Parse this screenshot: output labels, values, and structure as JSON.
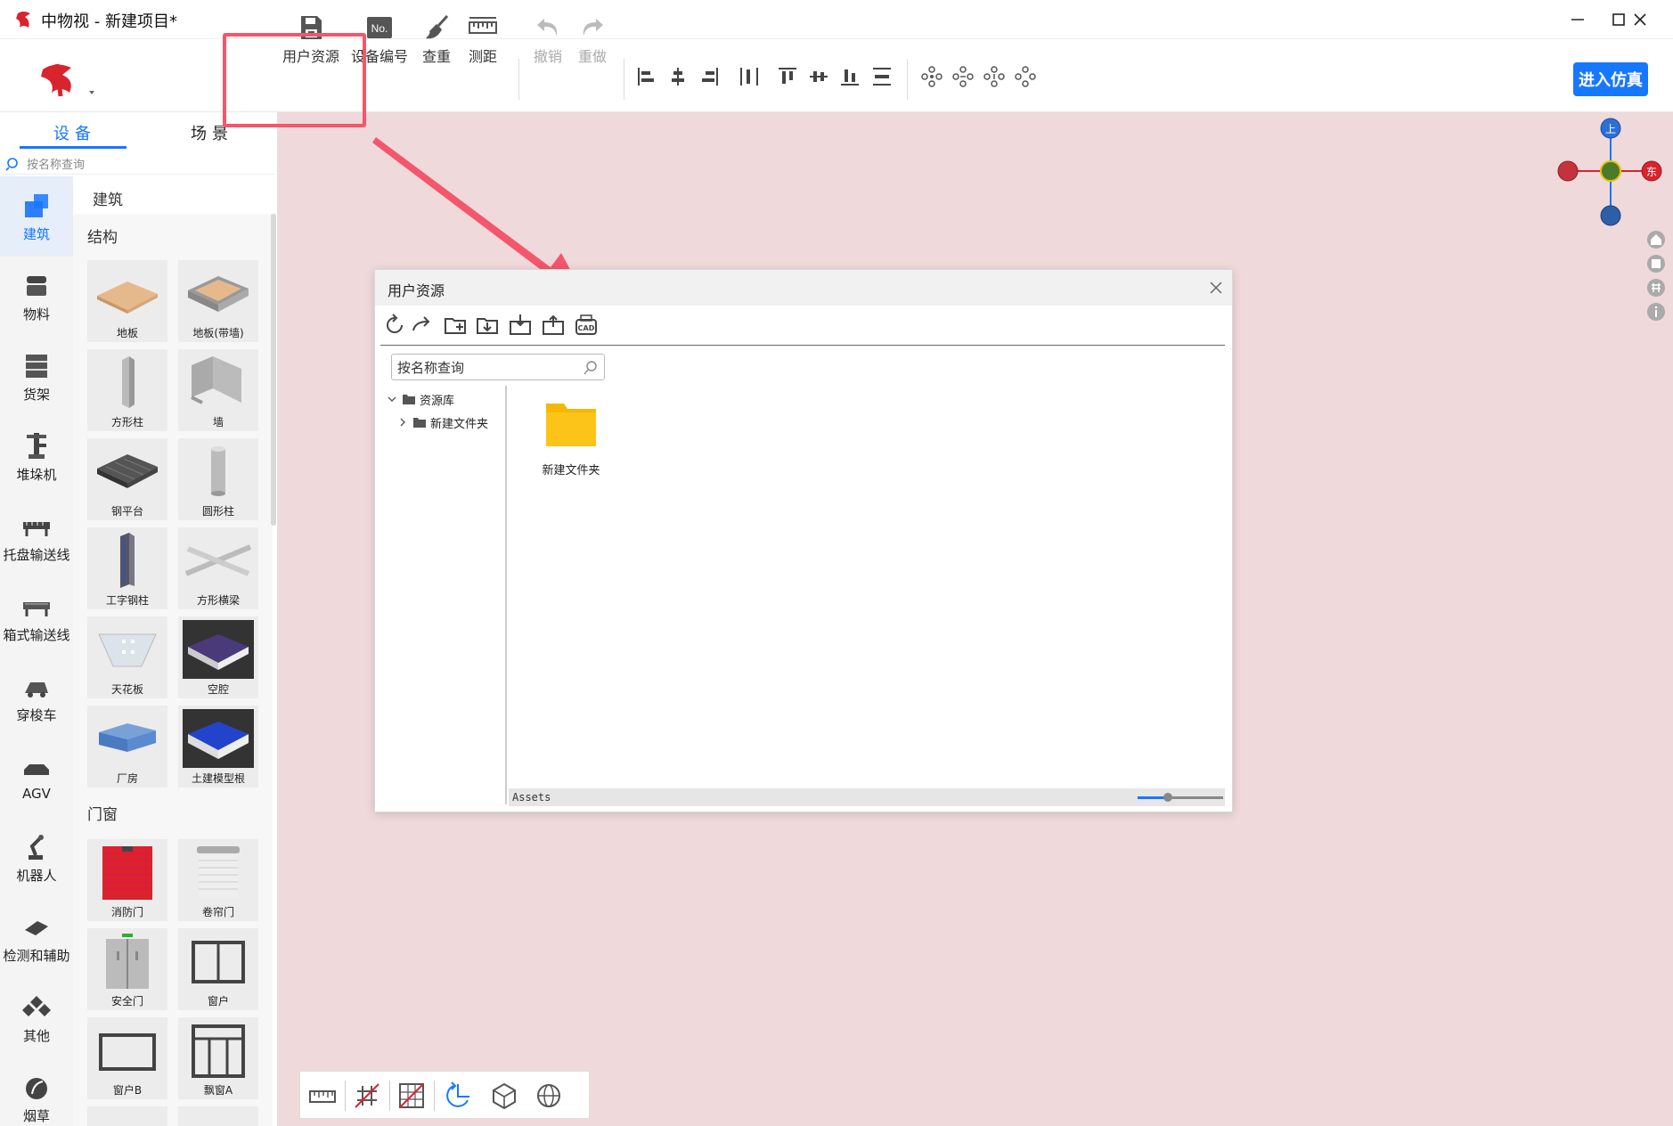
{
  "window": {
    "title": "中物视  -  新建项目*"
  },
  "toolbar": {
    "tools": [
      {
        "id": "user-resources",
        "label": "用户资源",
        "icon": "save-doc-icon"
      },
      {
        "id": "device-numbering",
        "label": "设备编号",
        "icon": "no-badge-icon"
      },
      {
        "id": "check-duplicate",
        "label": "查重",
        "icon": "broom-icon"
      },
      {
        "id": "measure",
        "label": "测距",
        "icon": "ruler-icon"
      },
      {
        "id": "undo",
        "label": "撤销",
        "icon": "undo-icon",
        "disabled": true
      },
      {
        "id": "redo",
        "label": "重做",
        "icon": "redo-icon",
        "disabled": true
      }
    ],
    "enter_sim_label": "进入仿真"
  },
  "left_panel": {
    "tabs": [
      {
        "label": "设备",
        "active": true
      },
      {
        "label": "场景",
        "active": false
      }
    ],
    "search_placeholder": "按名称查询",
    "categories": [
      {
        "label": "建筑",
        "icon": "building-icon",
        "active": true
      },
      {
        "label": "物料",
        "icon": "material-icon"
      },
      {
        "label": "货架",
        "icon": "shelf-icon"
      },
      {
        "label": "堆垛机",
        "icon": "stacker-icon"
      },
      {
        "label": "托盘输送线",
        "icon": "pallet-conveyor-icon"
      },
      {
        "label": "箱式输送线",
        "icon": "box-conveyor-icon"
      },
      {
        "label": "穿梭车",
        "icon": "shuttle-icon"
      },
      {
        "label": "AGV",
        "icon": "agv-icon"
      },
      {
        "label": "机器人",
        "icon": "robot-arm-icon"
      },
      {
        "label": "检测和辅助",
        "icon": "detection-icon"
      },
      {
        "label": "其他",
        "icon": "other-icon"
      },
      {
        "label": "烟草",
        "icon": "tobacco-icon"
      }
    ],
    "header_title": "建筑",
    "sections": [
      {
        "title": "结构",
        "items": [
          "地板",
          "地板(带墙)",
          "方形柱",
          "墙",
          "钢平台",
          "圆形柱",
          "工字钢柱",
          "方形横梁",
          "天花板",
          "空腔",
          "厂房",
          "土建模型根"
        ]
      },
      {
        "title": "门窗",
        "items": [
          "消防门",
          "卷帘门",
          "安全门",
          "窗户",
          "窗户B",
          "飘窗A"
        ]
      }
    ]
  },
  "dialog": {
    "title": "用户资源",
    "search_placeholder": "按名称查询",
    "tree": [
      {
        "label": "资源库",
        "expanded": true,
        "level": 0
      },
      {
        "label": "新建文件夹",
        "expanded": false,
        "level": 1
      }
    ],
    "files": [
      {
        "label": "新建文件夹",
        "icon": "folder-icon"
      }
    ],
    "status_path": "Assets",
    "zoom_fraction": 0.35
  },
  "gizmo": {
    "labels": {
      "top": "上",
      "east": "东"
    }
  },
  "colors": {
    "accent": "#1677ff",
    "canvas": "#efd9db",
    "highlight": "#f4566b",
    "folder": "#fcc419"
  }
}
